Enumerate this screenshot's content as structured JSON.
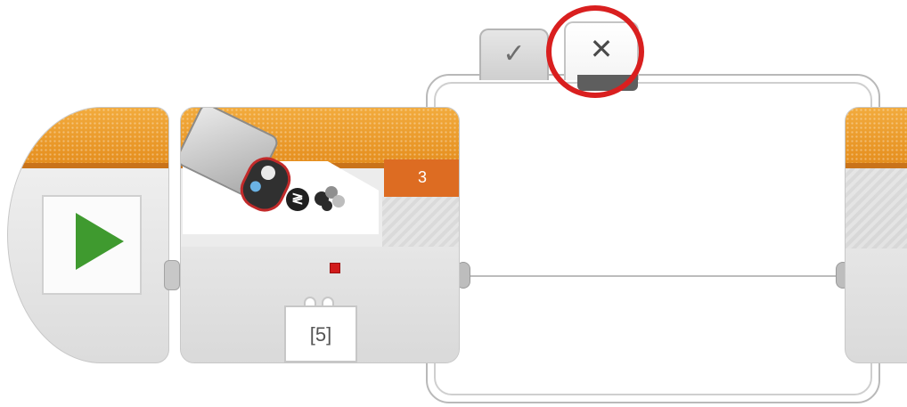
{
  "switch": {
    "tabs": [
      {
        "label": "✓",
        "state": "inactive"
      },
      {
        "label": "✕",
        "state": "active"
      }
    ],
    "highlight_color": "#d91f1f"
  },
  "start_block": {
    "icon": "play-icon",
    "header_color": "#e8901e",
    "icon_color": "#3f9a2f"
  },
  "sensor_block": {
    "sensor_icon": "color-sensor-icon",
    "mode_icons": [
      "compare-icon",
      "color-icon"
    ],
    "compare_symbol": "≷",
    "port": "3",
    "port_color": "#dd6c22",
    "input_value": "[5]"
  },
  "right_block": {
    "header_color": "#e8901e"
  }
}
